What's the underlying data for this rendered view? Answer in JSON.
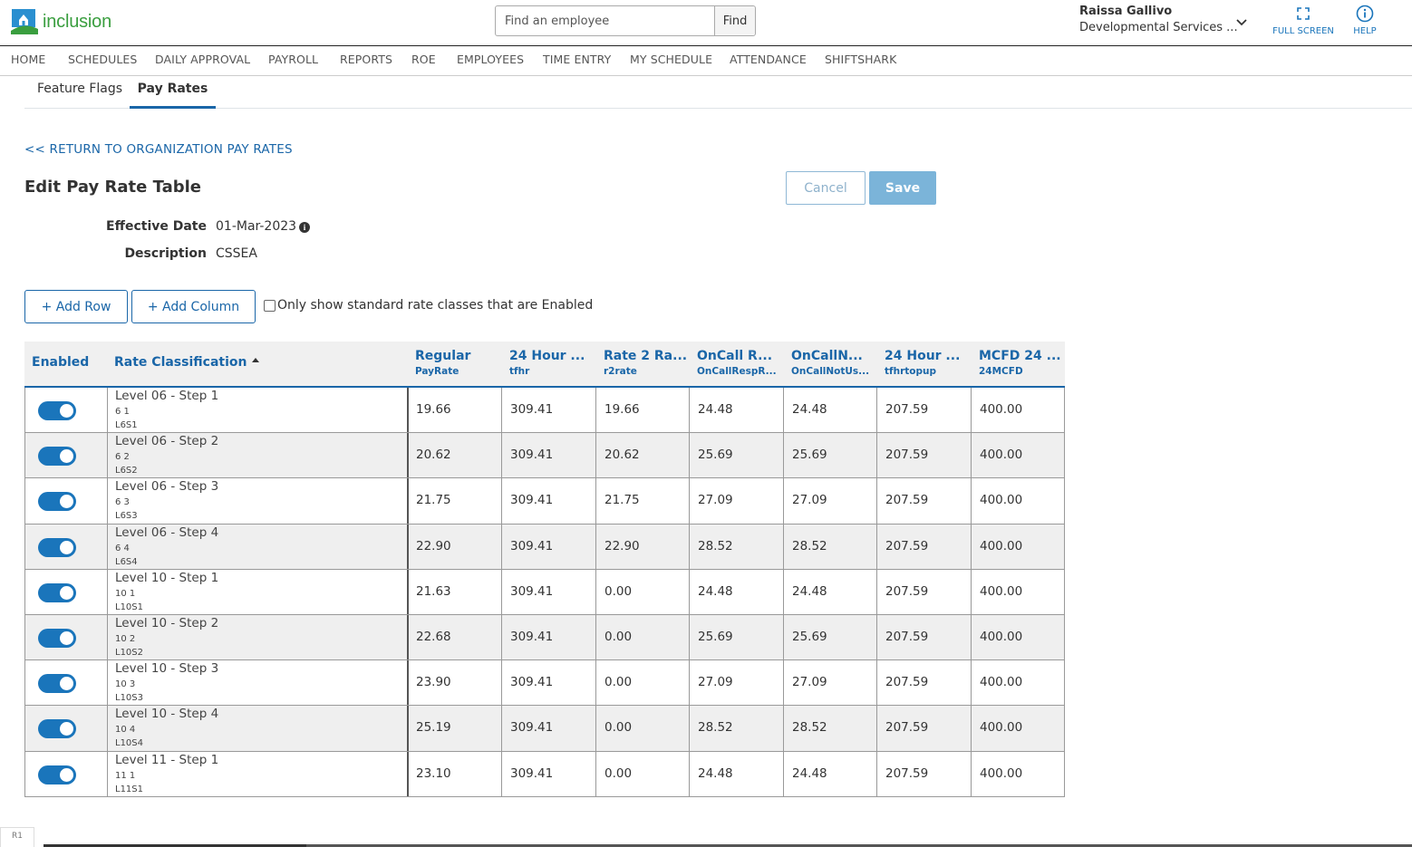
{
  "app": {
    "logo_text": "inclusion"
  },
  "search": {
    "placeholder": "Find an employee",
    "button": "Find"
  },
  "user": {
    "name": "Raissa Gallivo",
    "org": "Developmental Services ..."
  },
  "header_actions": {
    "fullscreen": "FULL SCREEN",
    "help": "HELP"
  },
  "nav": [
    "HOME",
    "SCHEDULES",
    "DAILY APPROVAL",
    "PAYROLL",
    "REPORTS",
    "ROE",
    "EMPLOYEES",
    "TIME ENTRY",
    "MY SCHEDULE",
    "ATTENDANCE",
    "SHIFTSHARK"
  ],
  "tabs": [
    "Feature Flags",
    "Pay Rates"
  ],
  "active_tab": "Pay Rates",
  "return_link": "<< RETURN TO ORGANIZATION PAY RATES",
  "page": {
    "title": "Edit Pay Rate Table",
    "cancel": "Cancel",
    "save": "Save",
    "effective_label": "Effective Date",
    "effective_value": "01-Mar-2023",
    "description_label": "Description",
    "description_value": "CSSEA"
  },
  "toolbar": {
    "add_row": "+ Add Row",
    "add_column": "+ Add Column",
    "filter_label": "Only show standard rate classes that are Enabled"
  },
  "table": {
    "headers": {
      "enabled": "Enabled",
      "rate_classification": "Rate Classification",
      "columns": [
        {
          "title": "Regular",
          "sub": "PayRate"
        },
        {
          "title": "24 Hour ...",
          "sub": "tfhr"
        },
        {
          "title": "Rate 2 Ra...",
          "sub": "r2rate"
        },
        {
          "title": "OnCall R...",
          "sub": "OnCallRespR..."
        },
        {
          "title": "OnCallN...",
          "sub": "OnCallNotUs..."
        },
        {
          "title": "24 Hour ...",
          "sub": "tfhrtopup"
        },
        {
          "title": "MCFD 24 ...",
          "sub": "24MCFD"
        }
      ]
    },
    "rows": [
      {
        "enabled": true,
        "name": "Level 06 - Step 1",
        "code": "6 1",
        "short": "L6S1",
        "values": [
          "19.66",
          "309.41",
          "19.66",
          "24.48",
          "24.48",
          "207.59",
          "400.00"
        ]
      },
      {
        "enabled": true,
        "name": "Level 06 - Step 2",
        "code": "6 2",
        "short": "L6S2",
        "values": [
          "20.62",
          "309.41",
          "20.62",
          "25.69",
          "25.69",
          "207.59",
          "400.00"
        ]
      },
      {
        "enabled": true,
        "name": "Level 06 - Step 3",
        "code": "6 3",
        "short": "L6S3",
        "values": [
          "21.75",
          "309.41",
          "21.75",
          "27.09",
          "27.09",
          "207.59",
          "400.00"
        ]
      },
      {
        "enabled": true,
        "name": "Level 06 - Step 4",
        "code": "6 4",
        "short": "L6S4",
        "values": [
          "22.90",
          "309.41",
          "22.90",
          "28.52",
          "28.52",
          "207.59",
          "400.00"
        ]
      },
      {
        "enabled": true,
        "name": "Level 10 - Step 1",
        "code": "10 1",
        "short": "L10S1",
        "values": [
          "21.63",
          "309.41",
          "0.00",
          "24.48",
          "24.48",
          "207.59",
          "400.00"
        ]
      },
      {
        "enabled": true,
        "name": "Level 10 - Step 2",
        "code": "10 2",
        "short": "L10S2",
        "values": [
          "22.68",
          "309.41",
          "0.00",
          "25.69",
          "25.69",
          "207.59",
          "400.00"
        ]
      },
      {
        "enabled": true,
        "name": "Level 10 - Step 3",
        "code": "10 3",
        "short": "L10S3",
        "values": [
          "23.90",
          "309.41",
          "0.00",
          "27.09",
          "27.09",
          "207.59",
          "400.00"
        ]
      },
      {
        "enabled": true,
        "name": "Level 10 - Step 4",
        "code": "10 4",
        "short": "L10S4",
        "values": [
          "25.19",
          "309.41",
          "0.00",
          "28.52",
          "28.52",
          "207.59",
          "400.00"
        ]
      },
      {
        "enabled": true,
        "name": "Level 11 - Step 1",
        "code": "11 1",
        "short": "L11S1",
        "values": [
          "23.10",
          "309.41",
          "0.00",
          "24.48",
          "24.48",
          "207.59",
          "400.00"
        ]
      }
    ]
  },
  "footer": {
    "sheet_tab": "R1"
  },
  "colors": {
    "accent": "#1a66a8",
    "toggle_on": "#1a75bb",
    "brand_green": "#3a9e3f"
  }
}
